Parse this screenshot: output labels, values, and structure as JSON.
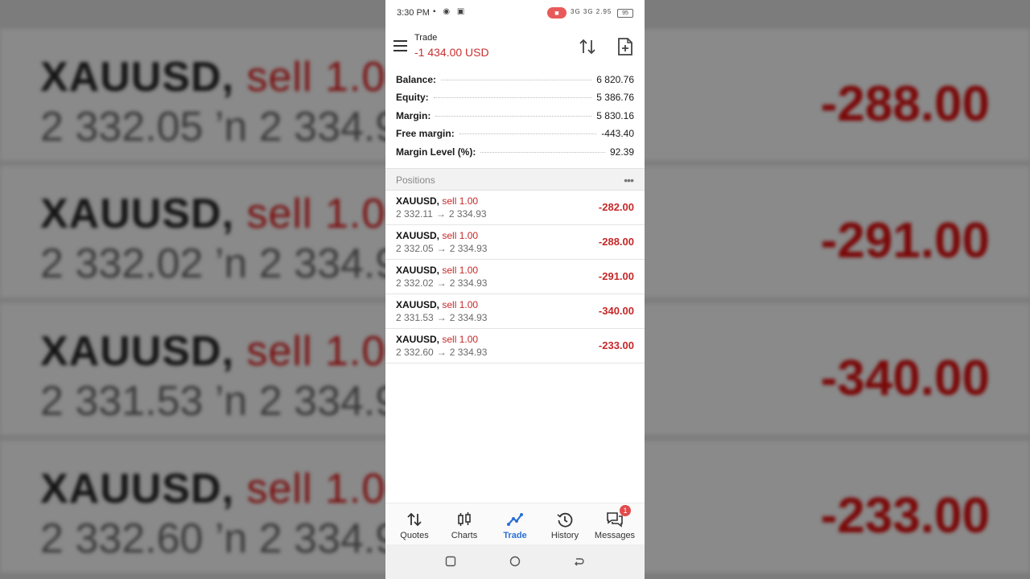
{
  "status_bar": {
    "time": "3:30 PM",
    "battery": "95",
    "network": "3G 3G 2.95"
  },
  "app_bar": {
    "title": "Trade",
    "subtitle": "-1 434.00 USD"
  },
  "account": [
    {
      "label": "Balance:",
      "value": "6 820.76"
    },
    {
      "label": "Equity:",
      "value": "5 386.76"
    },
    {
      "label": "Margin:",
      "value": "5 830.16"
    },
    {
      "label": "Free margin:",
      "value": "-443.40"
    },
    {
      "label": "Margin Level (%):",
      "value": "92.39"
    }
  ],
  "positions": {
    "title": "Positions",
    "items": [
      {
        "symbol": "XAUUSD,",
        "side": "sell 1.00",
        "open": "2 332.11",
        "current": "2 334.93",
        "profit": "-282.00"
      },
      {
        "symbol": "XAUUSD,",
        "side": "sell 1.00",
        "open": "2 332.05",
        "current": "2 334.93",
        "profit": "-288.00"
      },
      {
        "symbol": "XAUUSD,",
        "side": "sell 1.00",
        "open": "2 332.02",
        "current": "2 334.93",
        "profit": "-291.00"
      },
      {
        "symbol": "XAUUSD,",
        "side": "sell 1.00",
        "open": "2 331.53",
        "current": "2 334.93",
        "profit": "-340.00"
      },
      {
        "symbol": "XAUUSD,",
        "side": "sell 1.00",
        "open": "2 332.60",
        "current": "2 334.93",
        "profit": "-233.00"
      }
    ]
  },
  "arrow_glyph": "→",
  "bottom_nav": {
    "items": [
      {
        "label": "Quotes",
        "icon": "quotes-icon"
      },
      {
        "label": "Charts",
        "icon": "charts-icon"
      },
      {
        "label": "Trade",
        "icon": "trade-icon",
        "active": true
      },
      {
        "label": "History",
        "icon": "history-icon"
      },
      {
        "label": "Messages",
        "icon": "messages-icon",
        "badge": "1"
      }
    ]
  },
  "background": {
    "rows": [
      {
        "symbol": "XAUUSD,",
        "side": "sell 1.00",
        "prices": "2 332.05 ’n  2 334.9",
        "profit": "-288.00"
      },
      {
        "symbol": "XAUUSD,",
        "side": "sell 1.00",
        "prices": "2 332.02 ’n  2 334.9",
        "profit": "-291.00"
      },
      {
        "symbol": "XAUUSD,",
        "side": "sell 1.00",
        "prices": "2 331.53 ’n  2 334.9",
        "profit": "-340.00"
      },
      {
        "symbol": "XAUUSD,",
        "side": "sell 1.00",
        "prices": "2 332.60 ’n  2 334.9",
        "profit": "-233.00"
      }
    ]
  },
  "colors": {
    "loss": "#c62828",
    "active_tab": "#2a6fd6",
    "balance_header": "#c93030"
  }
}
